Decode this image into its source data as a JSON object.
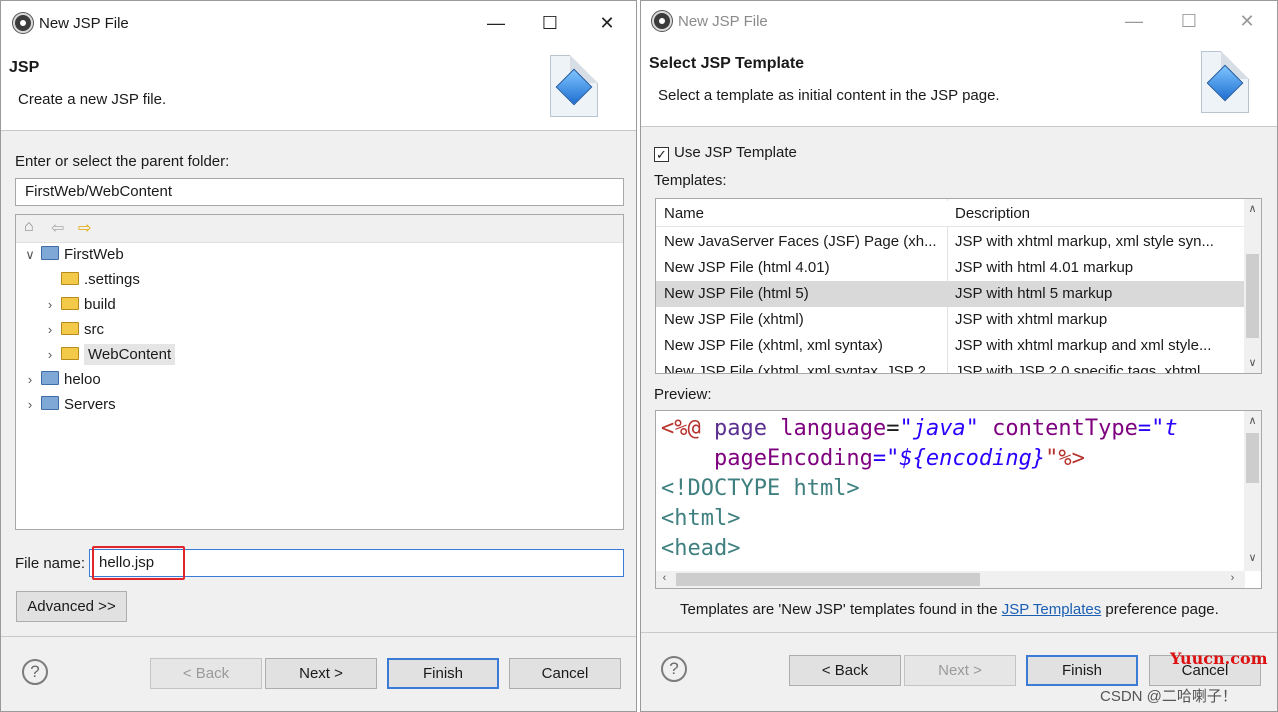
{
  "left_dialog": {
    "title": "New JSP File",
    "header_title": "JSP",
    "header_desc": "Create a new JSP file.",
    "folder_label": "Enter or select the parent folder:",
    "folder_value": "FirstWeb/WebContent",
    "tree_toolbar_icons": [
      "home-icon",
      "back-arrow-icon",
      "forward-arrow-icon"
    ],
    "tree": [
      {
        "label": "FirstWeb",
        "expanded": true,
        "level": 0,
        "icon": "project-icon"
      },
      {
        "label": ".settings",
        "level": 1,
        "icon": "folder-icon"
      },
      {
        "label": "build",
        "level": 1,
        "icon": "folder-icon"
      },
      {
        "label": "src",
        "level": 1,
        "icon": "folder-icon"
      },
      {
        "label": "WebContent",
        "level": 1,
        "icon": "folder-icon",
        "selected": true
      },
      {
        "label": "heloo",
        "level": 0,
        "icon": "project-icon"
      },
      {
        "label": "Servers",
        "level": 0,
        "icon": "folder-icon"
      }
    ],
    "filename_label": "File name:",
    "filename_value": "hello.jsp",
    "advanced_label": "Advanced >>",
    "buttons": {
      "back": "< Back",
      "next": "Next >",
      "finish": "Finish",
      "cancel": "Cancel"
    }
  },
  "right_dialog": {
    "title": "New JSP File",
    "header_title": "Select JSP Template",
    "header_desc": "Select a template as initial content in the JSP page.",
    "use_template_label": "Use JSP Template",
    "use_template_checked": true,
    "templates_label": "Templates:",
    "table_headers": [
      "Name",
      "Description"
    ],
    "table_rows": [
      [
        "New JavaServer Faces (JSF) Page (xh...",
        "JSP with xhtml markup, xml style syn..."
      ],
      [
        "New JSP File (html 4.01)",
        "JSP with html 4.01 markup"
      ],
      [
        "New JSP File (html 5)",
        "JSP with html 5 markup"
      ],
      [
        "New JSP File (xhtml)",
        "JSP with xhtml markup"
      ],
      [
        "New JSP File (xhtml, xml syntax)",
        "JSP with xhtml markup and xml style..."
      ],
      [
        "New JSP File (xhtml, xml syntax, JSP 2...",
        "JSP with JSP 2.0 specific tags, xhtml..."
      ]
    ],
    "selected_row": 2,
    "preview_label": "Preview:",
    "preview_lines": {
      "l1_a": "<%@",
      "l1_b": " page ",
      "l1_c": "language",
      "l1_d": "=",
      "l1_e": "\"java\"",
      "l1_f": " contentType",
      "l1_g": "=\"t",
      "l2_a": "    pageEncoding",
      "l2_b": "=\"",
      "l2_c": "${encoding}",
      "l2_d": "\"%>",
      "l3": "<!DOCTYPE html>",
      "l4": "<html>",
      "l5": "<head>"
    },
    "footer_pre": "Templates are 'New JSP' templates found in the ",
    "footer_link": "JSP Templates",
    "footer_post": " preference page.",
    "buttons": {
      "back": "< Back",
      "next": "Next >",
      "finish": "Finish",
      "cancel": "Cancel"
    }
  },
  "watermark": {
    "site": "Yuucn.com",
    "author": "CSDN @二哈喇子！"
  }
}
